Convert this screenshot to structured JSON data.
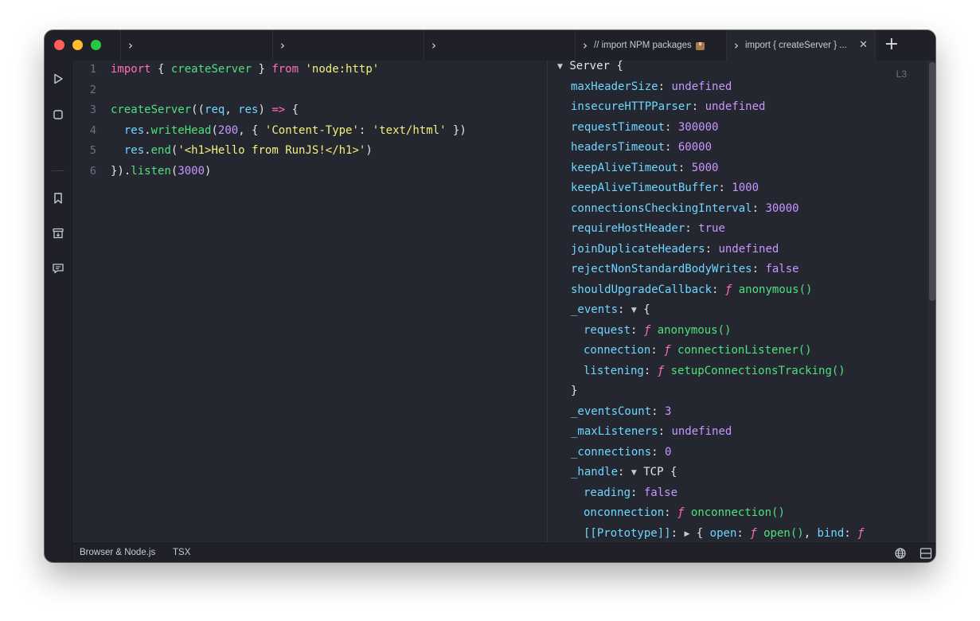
{
  "tabs": [
    {
      "label": ""
    },
    {
      "label": ""
    },
    {
      "label": ""
    },
    {
      "label": "// import NPM packages"
    },
    {
      "label": "import { createServer } ..."
    }
  ],
  "status": {
    "env": "Browser & Node.js",
    "lang": "TSX"
  },
  "editor": {
    "line_numbers": [
      "1",
      "2",
      "3",
      "4",
      "5",
      "6"
    ],
    "lines": [
      [
        [
          "kw",
          "import"
        ],
        [
          "plain",
          " { "
        ],
        [
          "fn",
          "createServer"
        ],
        [
          "plain",
          " } "
        ],
        [
          "kw",
          "from"
        ],
        [
          "plain",
          " "
        ],
        [
          "str",
          "'node:http'"
        ]
      ],
      [],
      [
        [
          "fn",
          "createServer"
        ],
        [
          "plain",
          "(("
        ],
        [
          "prop",
          "req"
        ],
        [
          "plain",
          ", "
        ],
        [
          "prop",
          "res"
        ],
        [
          "plain",
          ") "
        ],
        [
          "arrow",
          "=>"
        ],
        [
          "plain",
          " {"
        ]
      ],
      [
        [
          "plain",
          "  "
        ],
        [
          "prop",
          "res"
        ],
        [
          "plain",
          "."
        ],
        [
          "fn",
          "writeHead"
        ],
        [
          "plain",
          "("
        ],
        [
          "num",
          "200"
        ],
        [
          "plain",
          ", { "
        ],
        [
          "str",
          "'Content-Type'"
        ],
        [
          "plain",
          ": "
        ],
        [
          "str",
          "'text/html'"
        ],
        [
          "plain",
          " })"
        ]
      ],
      [
        [
          "plain",
          "  "
        ],
        [
          "prop",
          "res"
        ],
        [
          "plain",
          "."
        ],
        [
          "fn",
          "end"
        ],
        [
          "plain",
          "("
        ],
        [
          "str",
          "'<h1>Hello from RunJS!</h1>'"
        ],
        [
          "plain",
          ")"
        ]
      ],
      [
        [
          "plain",
          "})."
        ],
        [
          "fn",
          "listen"
        ],
        [
          "plain",
          "("
        ],
        [
          "num",
          "3000"
        ],
        [
          "plain",
          ")"
        ]
      ]
    ]
  },
  "result": {
    "line_tag": "L3",
    "rows": [
      {
        "indent": 0,
        "tri": "▼",
        "parts": [
          [
            "r-obj",
            "Server {"
          ]
        ]
      },
      {
        "indent": 1,
        "parts": [
          [
            "r-key",
            "maxHeaderSize"
          ],
          [
            "r-punct",
            ": "
          ],
          [
            "r-undef",
            "undefined"
          ]
        ]
      },
      {
        "indent": 1,
        "parts": [
          [
            "r-key",
            "insecureHTTPParser"
          ],
          [
            "r-punct",
            ": "
          ],
          [
            "r-undef",
            "undefined"
          ]
        ]
      },
      {
        "indent": 1,
        "parts": [
          [
            "r-key",
            "requestTimeout"
          ],
          [
            "r-punct",
            ": "
          ],
          [
            "r-num",
            "300000"
          ]
        ]
      },
      {
        "indent": 1,
        "parts": [
          [
            "r-key",
            "headersTimeout"
          ],
          [
            "r-punct",
            ": "
          ],
          [
            "r-num",
            "60000"
          ]
        ]
      },
      {
        "indent": 1,
        "parts": [
          [
            "r-key",
            "keepAliveTimeout"
          ],
          [
            "r-punct",
            ": "
          ],
          [
            "r-num",
            "5000"
          ]
        ]
      },
      {
        "indent": 1,
        "parts": [
          [
            "r-key",
            "keepAliveTimeoutBuffer"
          ],
          [
            "r-punct",
            ": "
          ],
          [
            "r-num",
            "1000"
          ]
        ]
      },
      {
        "indent": 1,
        "parts": [
          [
            "r-key",
            "connectionsCheckingInterval"
          ],
          [
            "r-punct",
            ": "
          ],
          [
            "r-num",
            "30000"
          ]
        ]
      },
      {
        "indent": 1,
        "parts": [
          [
            "r-key",
            "requireHostHeader"
          ],
          [
            "r-punct",
            ": "
          ],
          [
            "r-bool",
            "true"
          ]
        ]
      },
      {
        "indent": 1,
        "parts": [
          [
            "r-key",
            "joinDuplicateHeaders"
          ],
          [
            "r-punct",
            ": "
          ],
          [
            "r-undef",
            "undefined"
          ]
        ]
      },
      {
        "indent": 1,
        "parts": [
          [
            "r-key",
            "rejectNonStandardBodyWrites"
          ],
          [
            "r-punct",
            ": "
          ],
          [
            "r-bool",
            "false"
          ]
        ]
      },
      {
        "indent": 1,
        "parts": [
          [
            "r-key",
            "shouldUpgradeCallback"
          ],
          [
            "r-punct",
            ": "
          ],
          [
            "r-f",
            "ƒ"
          ],
          [
            "r-punct",
            " "
          ],
          [
            "r-fname",
            "anonymous()"
          ]
        ]
      },
      {
        "indent": 1,
        "parts": [
          [
            "r-key",
            "_events"
          ],
          [
            "r-punct",
            ": "
          ],
          [
            "tri",
            "▼"
          ],
          [
            "r-punct",
            " {"
          ]
        ]
      },
      {
        "indent": 2,
        "parts": [
          [
            "r-key",
            "request"
          ],
          [
            "r-punct",
            ": "
          ],
          [
            "r-f",
            "ƒ"
          ],
          [
            "r-punct",
            " "
          ],
          [
            "r-fname",
            "anonymous()"
          ]
        ]
      },
      {
        "indent": 2,
        "parts": [
          [
            "r-key",
            "connection"
          ],
          [
            "r-punct",
            ": "
          ],
          [
            "r-f",
            "ƒ"
          ],
          [
            "r-punct",
            " "
          ],
          [
            "r-fname",
            "connectionListener()"
          ]
        ]
      },
      {
        "indent": 2,
        "parts": [
          [
            "r-key",
            "listening"
          ],
          [
            "r-punct",
            ": "
          ],
          [
            "r-f",
            "ƒ"
          ],
          [
            "r-punct",
            " "
          ],
          [
            "r-fname",
            "setupConnectionsTracking()"
          ]
        ]
      },
      {
        "indent": 1,
        "parts": [
          [
            "r-punct",
            "}"
          ]
        ]
      },
      {
        "indent": 1,
        "parts": [
          [
            "r-key",
            "_eventsCount"
          ],
          [
            "r-punct",
            ": "
          ],
          [
            "r-num",
            "3"
          ]
        ]
      },
      {
        "indent": 1,
        "parts": [
          [
            "r-key",
            "_maxListeners"
          ],
          [
            "r-punct",
            ": "
          ],
          [
            "r-undef",
            "undefined"
          ]
        ]
      },
      {
        "indent": 1,
        "parts": [
          [
            "r-key",
            "_connections"
          ],
          [
            "r-punct",
            ": "
          ],
          [
            "r-num",
            "0"
          ]
        ]
      },
      {
        "indent": 1,
        "parts": [
          [
            "r-key",
            "_handle"
          ],
          [
            "r-punct",
            ": "
          ],
          [
            "tri",
            "▼"
          ],
          [
            "r-punct",
            " TCP {"
          ]
        ]
      },
      {
        "indent": 2,
        "parts": [
          [
            "r-key",
            "reading"
          ],
          [
            "r-punct",
            ": "
          ],
          [
            "r-bool",
            "false"
          ]
        ]
      },
      {
        "indent": 2,
        "parts": [
          [
            "r-key",
            "onconnection"
          ],
          [
            "r-punct",
            ": "
          ],
          [
            "r-f",
            "ƒ"
          ],
          [
            "r-punct",
            " "
          ],
          [
            "r-fname",
            "onconnection()"
          ]
        ]
      },
      {
        "indent": 2,
        "parts": [
          [
            "r-key",
            "[[Prototype]]"
          ],
          [
            "r-punct",
            ": "
          ],
          [
            "tri",
            "▶"
          ],
          [
            "r-punct",
            " { "
          ],
          [
            "r-key",
            "open"
          ],
          [
            "r-punct",
            ": "
          ],
          [
            "r-f",
            "ƒ"
          ],
          [
            "r-punct",
            " "
          ],
          [
            "r-fname",
            "open()"
          ],
          [
            "r-punct",
            ", "
          ],
          [
            "r-key",
            "bind"
          ],
          [
            "r-punct",
            ": "
          ],
          [
            "r-f",
            "ƒ"
          ]
        ]
      }
    ]
  },
  "icons": {
    "run": "play-icon",
    "stop": "stop-icon",
    "snippets": "bookmark-icon",
    "packages": "archive-icon",
    "feedback": "message-icon",
    "settings": "gear-icon",
    "globe": "globe-icon",
    "layout": "split-layout-icon"
  }
}
